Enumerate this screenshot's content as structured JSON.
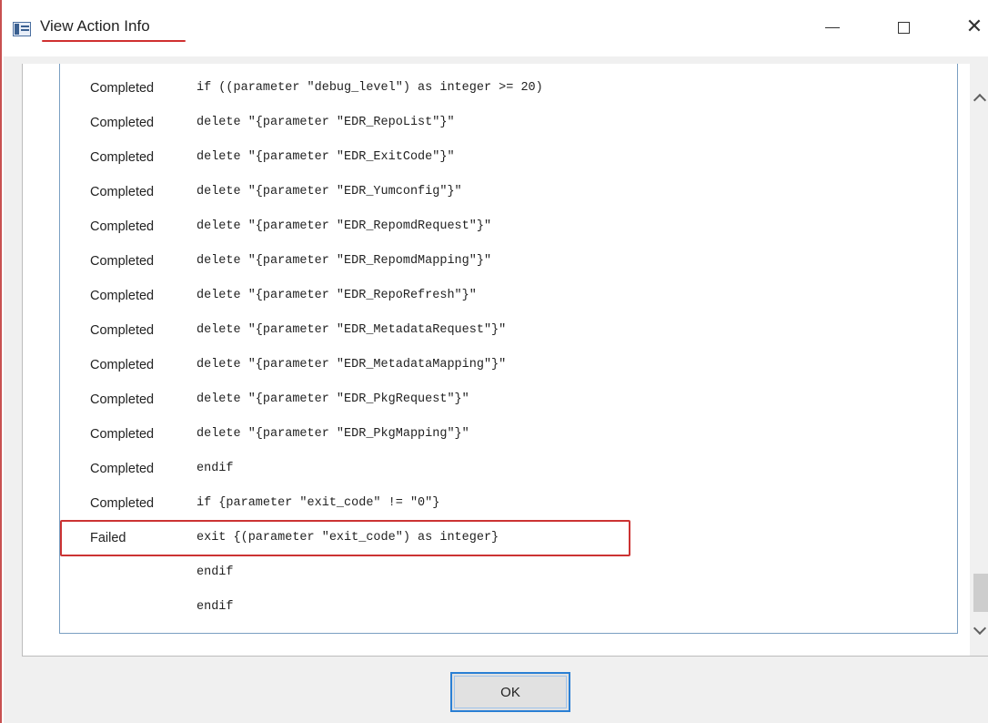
{
  "window": {
    "title": "View Action Info",
    "minimize_glyph": "minimize",
    "maximize_glyph": "maximize",
    "close_glyph": "✕"
  },
  "rows": [
    {
      "status": "Completed",
      "command": "if ((parameter \"debug_level\") as integer >= 20)"
    },
    {
      "status": "Completed",
      "command": "delete \"{parameter \"EDR_RepoList\"}\""
    },
    {
      "status": "Completed",
      "command": "delete \"{parameter \"EDR_ExitCode\"}\""
    },
    {
      "status": "Completed",
      "command": "delete \"{parameter \"EDR_Yumconfig\"}\""
    },
    {
      "status": "Completed",
      "command": "delete \"{parameter \"EDR_RepomdRequest\"}\""
    },
    {
      "status": "Completed",
      "command": "delete \"{parameter \"EDR_RepomdMapping\"}\""
    },
    {
      "status": "Completed",
      "command": "delete \"{parameter \"EDR_RepoRefresh\"}\""
    },
    {
      "status": "Completed",
      "command": "delete \"{parameter \"EDR_MetadataRequest\"}\""
    },
    {
      "status": "Completed",
      "command": "delete \"{parameter \"EDR_MetadataMapping\"}\""
    },
    {
      "status": "Completed",
      "command": "delete \"{parameter \"EDR_PkgRequest\"}\""
    },
    {
      "status": "Completed",
      "command": "delete \"{parameter \"EDR_PkgMapping\"}\""
    },
    {
      "status": "Completed",
      "command": "endif"
    },
    {
      "status": "Completed",
      "command": "if {parameter \"exit_code\" != \"0\"}"
    },
    {
      "status": "Failed",
      "command": "exit {(parameter \"exit_code\") as integer}"
    },
    {
      "status": "",
      "command": "endif"
    },
    {
      "status": "",
      "command": "endif"
    }
  ],
  "footer": {
    "ok_label": "OK"
  },
  "colors": {
    "highlight_border": "#cc3333",
    "title_underline": "#d03030",
    "ok_focus": "#2a7fd4",
    "list_border": "#7a9fc2"
  },
  "icons": {
    "app": "app-window-icon",
    "scroll_up": "chevron-up-icon",
    "scroll_down": "chevron-down-icon"
  }
}
